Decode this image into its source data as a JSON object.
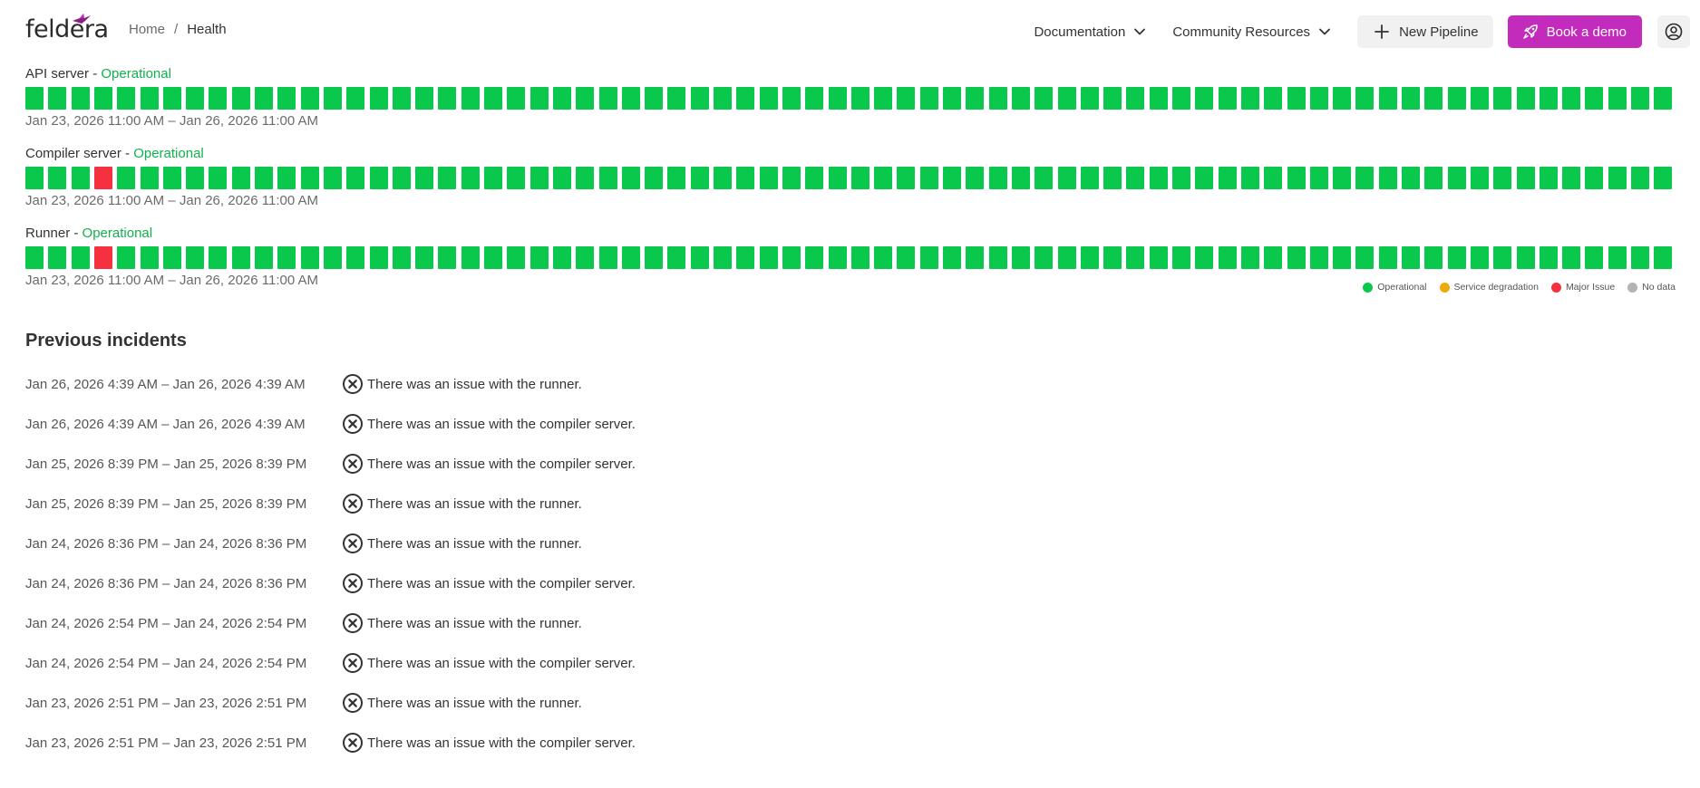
{
  "header": {
    "logo_text": "feldera",
    "breadcrumb": {
      "home": "Home",
      "separator": "/",
      "current": "Health"
    },
    "nav": {
      "documentation": "Documentation",
      "community": "Community Resources",
      "new_pipeline": "New Pipeline",
      "book_demo": "Book a demo"
    },
    "icons": [
      "feldera-logo-icon",
      "chevron-down-icon",
      "plus-icon",
      "rocket-icon",
      "user-circle-icon"
    ]
  },
  "colors": {
    "operational": "#0ac84c",
    "degradation": "#f0a80a",
    "major": "#f5303f",
    "nodata": "#b3b3b3",
    "brand": "#c32bbd",
    "status_text": "#12b04c"
  },
  "services": [
    {
      "name": "API server",
      "separator": "-",
      "status": "Operational",
      "range": "Jan 23, 2026 11:00 AM – Jan 26, 2026 11:00 AM",
      "bars": "oooooooooooooooooooooooooooooooooooooooooooooooooooooooooooooooooooooooo"
    },
    {
      "name": "Compiler server",
      "separator": "-",
      "status": "Operational",
      "range": "Jan 23, 2026 11:00 AM – Jan 26, 2026 11:00 AM",
      "bars": "oooxoooooooooooooooooooooooooooooooooooooooooooooooooooooooooooooooooooo"
    },
    {
      "name": "Runner",
      "separator": "-",
      "status": "Operational",
      "range": "Jan 23, 2026 11:00 AM – Jan 26, 2026 11:00 AM",
      "bars": "oooxoooooooooooooooooooooooooooooooooooooooooooooooooooooooooooooooooooo"
    }
  ],
  "legend": [
    {
      "label": "Operational",
      "color": "#0ac84c"
    },
    {
      "label": "Service degradation",
      "color": "#f0a80a"
    },
    {
      "label": "Major Issue",
      "color": "#f5303f"
    },
    {
      "label": "No data",
      "color": "#b3b3b3"
    }
  ],
  "incidents": {
    "title": "Previous incidents",
    "items": [
      {
        "range": "Jan 26, 2026 4:39 AM – Jan 26, 2026 4:39 AM",
        "text": "There was an issue with the runner."
      },
      {
        "range": "Jan 26, 2026 4:39 AM – Jan 26, 2026 4:39 AM",
        "text": "There was an issue with the compiler server."
      },
      {
        "range": "Jan 25, 2026 8:39 PM – Jan 25, 2026 8:39 PM",
        "text": "There was an issue with the compiler server."
      },
      {
        "range": "Jan 25, 2026 8:39 PM – Jan 25, 2026 8:39 PM",
        "text": "There was an issue with the runner."
      },
      {
        "range": "Jan 24, 2026 8:36 PM – Jan 24, 2026 8:36 PM",
        "text": "There was an issue with the runner."
      },
      {
        "range": "Jan 24, 2026 8:36 PM – Jan 24, 2026 8:36 PM",
        "text": "There was an issue with the compiler server."
      },
      {
        "range": "Jan 24, 2026 2:54 PM – Jan 24, 2026 2:54 PM",
        "text": "There was an issue with the runner."
      },
      {
        "range": "Jan 24, 2026 2:54 PM – Jan 24, 2026 2:54 PM",
        "text": "There was an issue with the compiler server."
      },
      {
        "range": "Jan 23, 2026 2:51 PM – Jan 23, 2026 2:51 PM",
        "text": "There was an issue with the runner."
      },
      {
        "range": "Jan 23, 2026 2:51 PM – Jan 23, 2026 2:51 PM",
        "text": "There was an issue with the compiler server."
      }
    ]
  }
}
